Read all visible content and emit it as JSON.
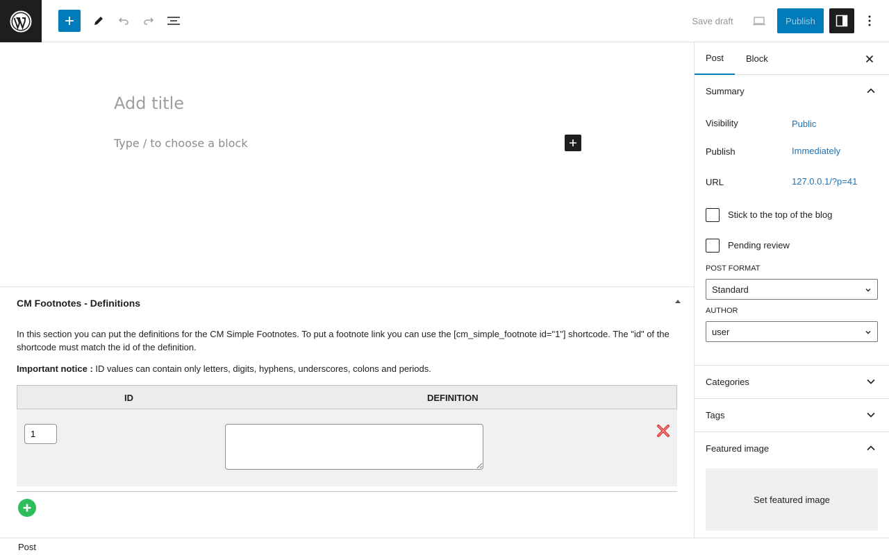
{
  "toolbar": {
    "save_draft": "Save draft",
    "publish": "Publish",
    "icons": [
      "wordpress-logo",
      "plus",
      "pencil",
      "undo",
      "redo",
      "list-view",
      "laptop-preview",
      "sidebar-settings",
      "more-vertical"
    ]
  },
  "editor": {
    "title_placeholder": "Add title",
    "block_placeholder": "Type / to choose a block"
  },
  "metabox": {
    "title": "CM Footnotes - Definitions",
    "description": "In this section you can put the definitions for the CM Simple Footnotes. To put a footnote link you can use the [cm_simple_footnote id=\"1\"] shortcode. The \"id\" of the shortcode must match the id of the definition.",
    "notice_label": "Important notice :",
    "notice_text": "ID values can contain only letters, digits, hyphens, underscores, colons and periods.",
    "table": {
      "columns": [
        "ID",
        "DEFINITION"
      ],
      "rows": [
        {
          "id": "1",
          "definition": ""
        }
      ]
    }
  },
  "sidebar": {
    "tabs": [
      "Post",
      "Block"
    ],
    "summary": {
      "title": "Summary",
      "visibility_label": "Visibility",
      "visibility_value": "Public",
      "publish_label": "Publish",
      "publish_value": "Immediately",
      "url_label": "URL",
      "url_value": "127.0.0.1/?p=41",
      "sticky_label": "Stick to the top of the blog",
      "pending_label": "Pending review",
      "post_format_label": "POST FORMAT",
      "post_format_value": "Standard",
      "author_label": "AUTHOR",
      "author_value": "user"
    },
    "categories": "Categories",
    "tags": "Tags",
    "featured_image": "Featured image",
    "set_featured_image": "Set featured image"
  },
  "footer": {
    "breadcrumb": "Post"
  },
  "colors": {
    "accent": "#007cba",
    "link": "#2271b1",
    "add_green": "#2ebd5b",
    "delete_red": "#d63638"
  }
}
